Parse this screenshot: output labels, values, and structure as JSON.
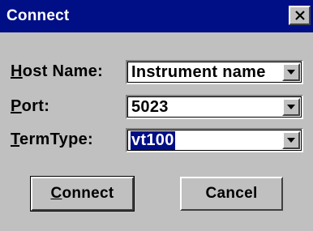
{
  "window": {
    "title": "Connect",
    "close_label": "×"
  },
  "form": {
    "host": {
      "mnemonic": "H",
      "rest": "ost Name:",
      "value": "Instrument name"
    },
    "port": {
      "mnemonic": "P",
      "rest": "ort:",
      "value": "5023"
    },
    "termtype": {
      "mnemonic": "T",
      "rest": "ermType:",
      "value": "vt100"
    }
  },
  "buttons": {
    "connect": {
      "mnemonic": "C",
      "rest": "onnect"
    },
    "cancel": {
      "label": "Cancel"
    }
  },
  "colors": {
    "titlebar": "#010f86",
    "face": "#c0c0c0"
  }
}
